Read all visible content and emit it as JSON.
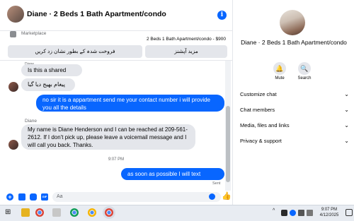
{
  "header": {
    "title": "Diane · 2 Beds 1 Bath Apartment/condo",
    "info_icon": "i"
  },
  "marketplace": {
    "label": "Marketplace",
    "listing": "2 Beds 1 Bath Apartment/condo - $900",
    "button_left": "فروخت شدہ کے بطور نشان زد کریں",
    "button_right": "مزید آپشنز"
  },
  "messages": {
    "top_sender": "Diane",
    "items": [
      {
        "from": "them",
        "text": "Is this a shared condo?"
      },
      {
        "from": "them",
        "text": "پیغام بھیج دیا گیا"
      },
      {
        "from": "me",
        "text": "no sir it is a appartment send me your contact number i will provide you all the details"
      },
      {
        "from": "them",
        "sender": "Diane",
        "text": "My name is Diane Henderson and I can be reached at 209-561-2612.  If I don't pick up, please leave a voicemail message and I will call you back.  Thanks."
      },
      {
        "from": "me",
        "text": "as soon as possible I will text you..Thanks"
      }
    ],
    "timestamp": "9:07 PM",
    "status": "Sent"
  },
  "composer": {
    "placeholder": "Aa"
  },
  "right_panel": {
    "name": "Diane · 2 Beds 1 Bath Apartment/condo",
    "mute_label": "Mute",
    "search_label": "Search",
    "sections": [
      "Customize chat",
      "Chat members",
      "Media, files and links",
      "Privacy & support"
    ]
  },
  "taskbar": {
    "time": "9:07 PM",
    "date": "4/12/2025",
    "tray_chevron": "^"
  },
  "colors": {
    "accent": "#0866ff",
    "incoming_bubble": "#e4e6eb"
  }
}
